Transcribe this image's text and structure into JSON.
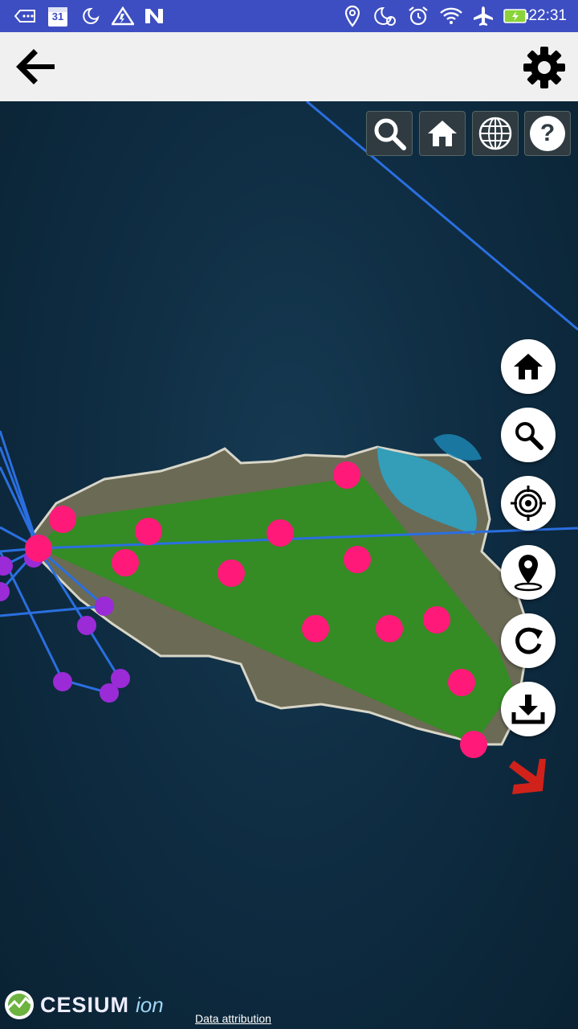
{
  "status_bar": {
    "time": "22:31",
    "calendar_day": "31",
    "icons": [
      "voicemail-icon",
      "calendar-icon",
      "do-not-disturb-icon",
      "warning-icon",
      "n-app-icon",
      "location-icon",
      "do-not-disturb-alarm-icon",
      "alarm-icon",
      "wifi-icon",
      "airplane-icon",
      "battery-charging-icon"
    ]
  },
  "app_bar": {
    "back_icon": "arrow-left-icon",
    "settings_icon": "gear-icon"
  },
  "map": {
    "toolbar": [
      "search-icon",
      "home-icon",
      "globe-icon",
      "help-icon"
    ],
    "help_label": "?",
    "side_buttons": [
      "home-icon",
      "search-icon",
      "target-icon",
      "location-pin-icon",
      "refresh-icon",
      "download-icon"
    ],
    "compass": "chevron-arrow-icon",
    "colors": {
      "polygon_fill": "#2e8f1e",
      "marker_pink": "#ff1a7a",
      "marker_purple": "#9b2bd6",
      "lines_blue": "#2a6fe0",
      "compass_red": "#d0221a"
    }
  },
  "footer": {
    "logo_text": "CESIUM",
    "logo_suffix": "ion",
    "attribution": "Data attribution"
  }
}
